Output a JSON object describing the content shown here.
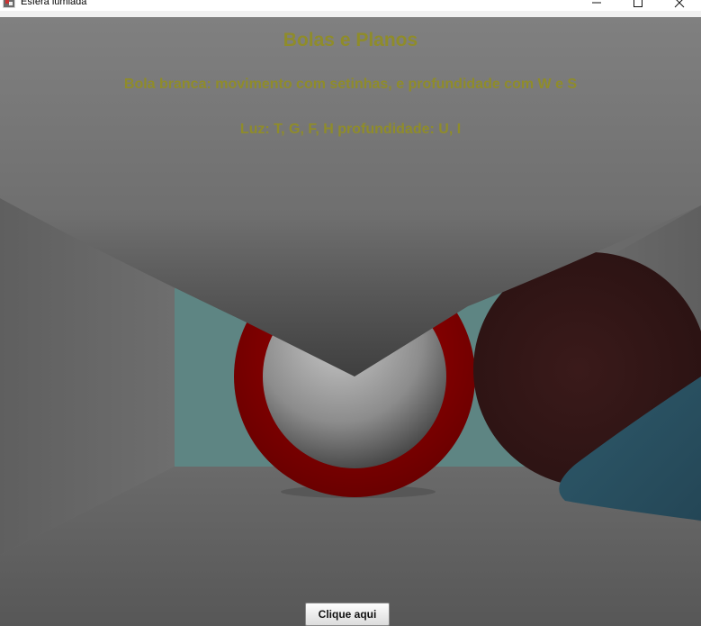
{
  "window": {
    "title": "Esfera lumiada",
    "icon": "java-app-icon",
    "controls": {
      "minimize": "minimize-icon",
      "maximize": "maximize-icon",
      "close": "close-icon"
    }
  },
  "scene": {
    "heading": "Bolas e Planos",
    "instructions": [
      "Bola branca: movimento com setinhas, e profundidade com W e S",
      "Luz: T, G, F, H  profundidade: U, I"
    ],
    "text_color": "#8f8c2a"
  },
  "button": {
    "label": "Clique aqui"
  }
}
